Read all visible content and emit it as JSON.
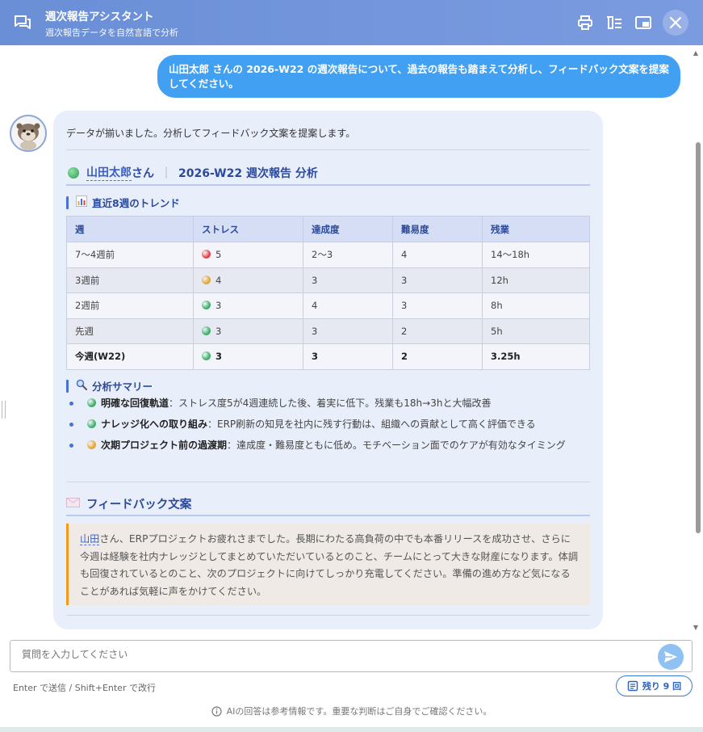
{
  "header": {
    "title": "週次報告アシスタント",
    "subtitle": "週次報告データを自然言語で分析"
  },
  "user_message": "山田太郎 さんの 2026-W22 の週次報告について、過去の報告も踏まえて分析し、フィードバック文案を提案してください。",
  "bot": {
    "intro": "データが揃いました。分析してフィードバック文案を提案します。",
    "heading_name": "山田太郎",
    "heading_suffix": "さん",
    "heading_sep": "｜",
    "heading_rest": "2026-W22 週次報告 分析",
    "trend_title": "直近8週のトレンド",
    "table": {
      "headers": [
        "週",
        "ストレス",
        "達成度",
        "難易度",
        "残業"
      ],
      "rows": [
        {
          "week": "7〜4週前",
          "stress": "5",
          "stress_color": "#e0444a",
          "achievement": "2〜3",
          "difficulty": "4",
          "overtime": "14〜18h"
        },
        {
          "week": "3週前",
          "stress": "4",
          "stress_color": "#e2a53a",
          "achievement": "3",
          "difficulty": "3",
          "overtime": "12h"
        },
        {
          "week": "2週前",
          "stress": "3",
          "stress_color": "#3fb06a",
          "achievement": "4",
          "difficulty": "3",
          "overtime": "8h"
        },
        {
          "week": "先週",
          "stress": "3",
          "stress_color": "#3fb06a",
          "achievement": "3",
          "difficulty": "2",
          "overtime": "5h"
        },
        {
          "week": "今週(W22)",
          "stress": "3",
          "stress_color": "#3fb06a",
          "achievement": "3",
          "difficulty": "2",
          "overtime": "3.25h"
        }
      ]
    },
    "summary_title": "分析サマリー",
    "summary": [
      {
        "label": "明確な回復軌道",
        "text": "：ストレス度5が4週連続した後、着実に低下。残業も18h→3hと大幅改善",
        "dot": "#3fb06a"
      },
      {
        "label": "ナレッジ化への取り組み",
        "text": "：ERP刷新の知見を社内に残す行動は、組織への貢献として高く評価できる",
        "dot": "#3fb06a"
      },
      {
        "label": "次期プロジェクト前の過渡期",
        "text": "：達成度・難易度ともに低め。モチベーション面でのケアが有効なタイミング",
        "dot": "#e2a53a"
      }
    ],
    "feedback_title": "フィードバック文案",
    "feedback_name": "山田",
    "feedback_text": "さん、ERPプロジェクトお疲れさまでした。長期にわたる高負荷の中でも本番リリースを成功させ、さらに今週は経験を社内ナレッジとしてまとめていただいているとのこと、チームにとって大きな財産になります。体調も回復されているとのこと、次のプロジェクトに向けてしっかり充電してください。準備の進め方など気になることがあれば気軽に声をかけてください。"
  },
  "input": {
    "placeholder": "質問を入力してください"
  },
  "hint": "Enter で送信 / Shift+Enter で改行",
  "remaining": "残り 9 回",
  "disclaimer": "AIの回答は参考情報です。重要な判断はご自身でご確認ください。"
}
